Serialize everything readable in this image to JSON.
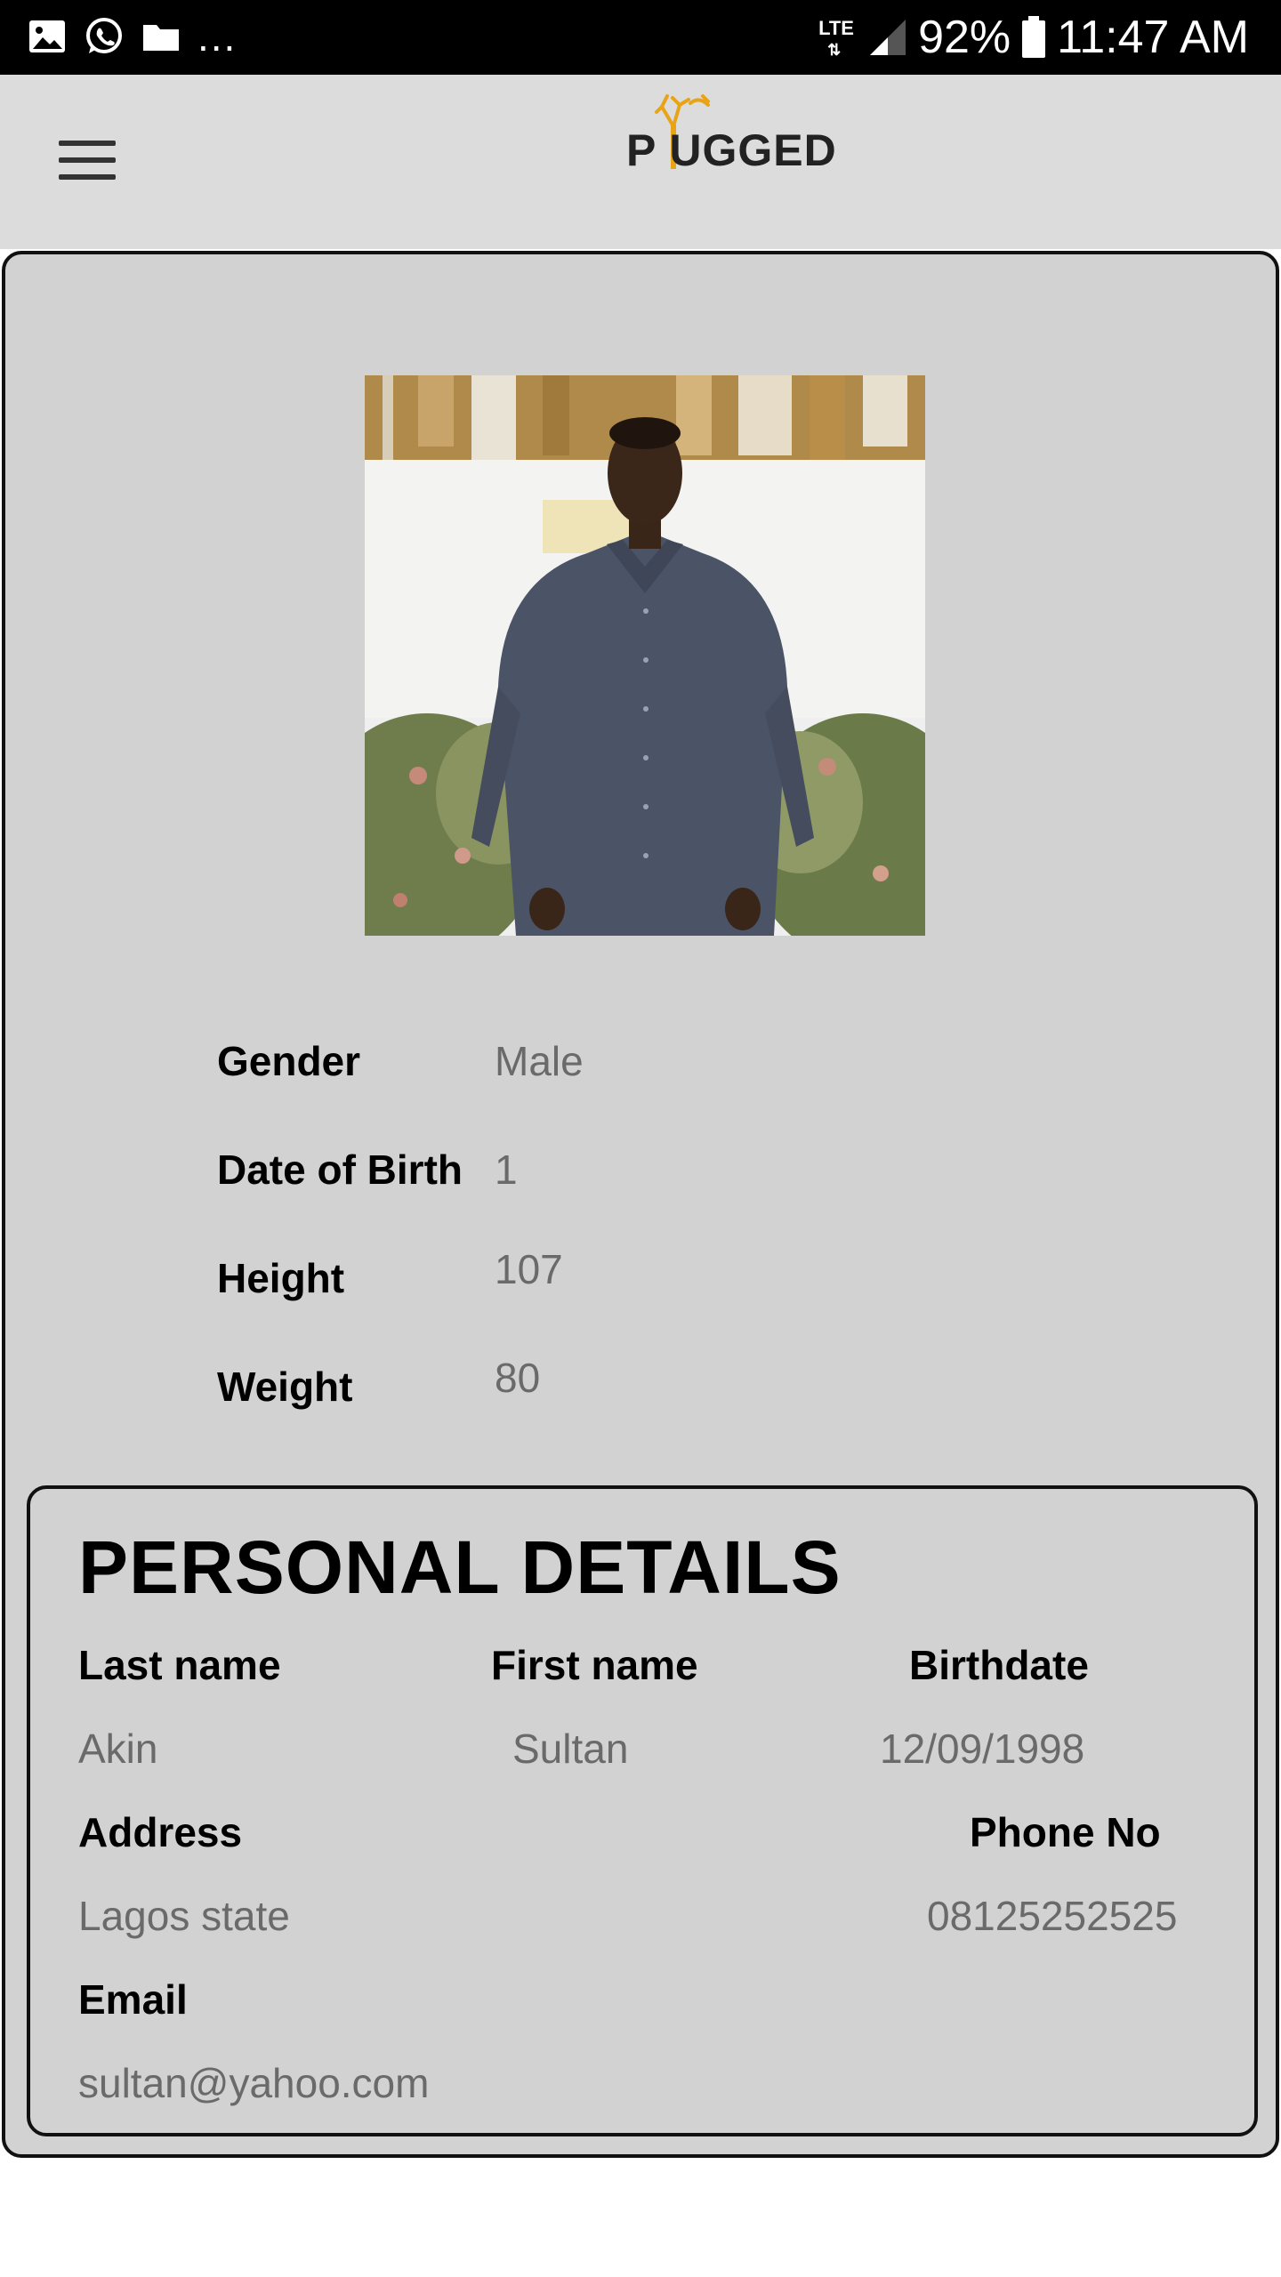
{
  "status_bar": {
    "left_icons": [
      "image-icon",
      "whatsapp-icon",
      "folder-icon"
    ],
    "more": "...",
    "network": "LTE",
    "battery": "92%",
    "time": "11:47 AM"
  },
  "header": {
    "menu_icon": "hamburger-menu-icon",
    "logo_text": "P UGGED",
    "logo_accent_color": "#e8a317"
  },
  "profile": {
    "photo_alt": "profile-photo",
    "info": [
      {
        "label": "Gender",
        "value": "Male"
      },
      {
        "label": "Date of Birth",
        "value": "1"
      },
      {
        "label": "Height",
        "value": "107"
      },
      {
        "label": "Weight",
        "value": "80"
      }
    ]
  },
  "personal_details": {
    "title": "PERSONAL DETAILS",
    "last_name_label": "Last name",
    "last_name": "Akin",
    "first_name_label": "First name",
    "first_name": "Sultan",
    "birthdate_label": "Birthdate",
    "birthdate": "12/09/1998",
    "address_label": "Address",
    "address": "Lagos state",
    "phone_label": "Phone No",
    "phone": "08125252525",
    "email_label": "Email",
    "email": "sultan@yahoo.com"
  },
  "colors": {
    "header_bg": "#dcdcdc",
    "card_bg": "#d2d2d2",
    "value_text": "#6a6a6a"
  }
}
